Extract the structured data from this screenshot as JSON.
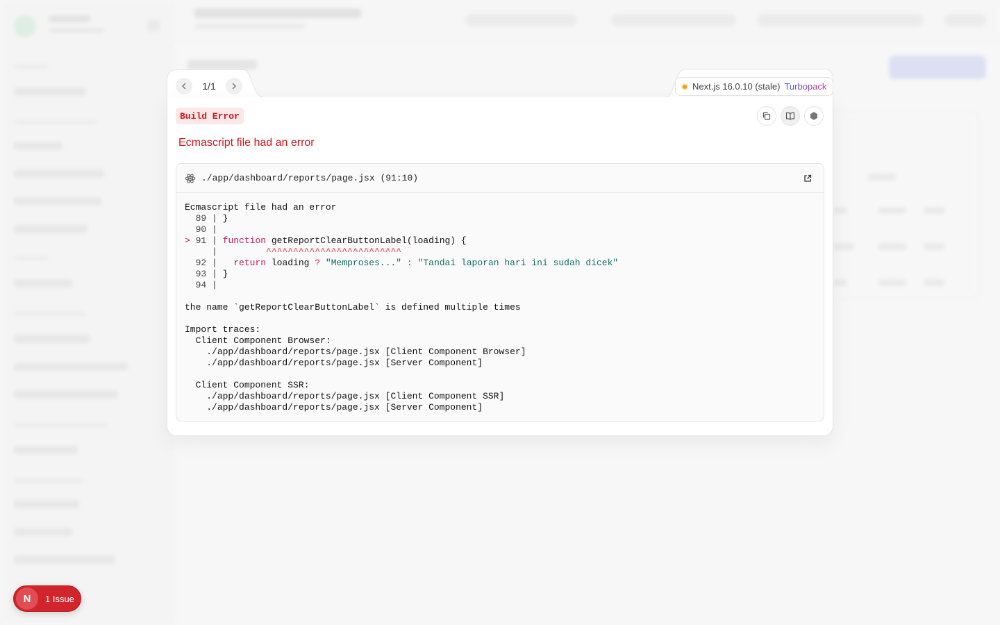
{
  "pager": {
    "label": "1/1"
  },
  "version": {
    "text": "Next.js 16.0.10 (stale)",
    "bundler": "Turbopack"
  },
  "badge": {
    "label": "Build Error"
  },
  "error": {
    "title": "Ecmascript file had an error"
  },
  "code": {
    "file": "./app/dashboard/reports/page.jsx (91:10)",
    "message_heading": "Ecmascript file had an error",
    "lines": [
      {
        "marker": " ",
        "num": "89",
        "text": "}"
      },
      {
        "marker": " ",
        "num": "90",
        "text": ""
      },
      {
        "marker": ">",
        "num": "91",
        "keyword": "function",
        "text": " getReportClearButtonLabel(loading) {"
      },
      {
        "marker": " ",
        "num": "",
        "carets": "^^^^^^^^^^^^^^^^^^^^^^^^^"
      },
      {
        "marker": " ",
        "num": "92",
        "keyword": "return",
        "text_before": " loading ",
        "op": "?",
        "string1": "\"Memproses...\"",
        "op2": ":",
        "string2": "\"Tandai laporan hari ini sudah dicek\""
      },
      {
        "marker": " ",
        "num": "93",
        "text": "}"
      },
      {
        "marker": " ",
        "num": "94",
        "text": ""
      }
    ],
    "detail": "the name `getReportClearButtonLabel` is defined multiple times",
    "import_traces_heading": "Import traces:",
    "traces": [
      {
        "name": "Client Component Browser:",
        "items": [
          "./app/dashboard/reports/page.jsx [Client Component Browser]",
          "./app/dashboard/reports/page.jsx [Server Component]"
        ]
      },
      {
        "name": "Client Component SSR:",
        "items": [
          "./app/dashboard/reports/page.jsx [Client Component SSR]",
          "./app/dashboard/reports/page.jsx [Server Component]"
        ]
      }
    ]
  },
  "issues": {
    "avatar": "N",
    "label": "1 Issue"
  },
  "colors": {
    "error_red": "#d0161b",
    "badge_bg": "#fde8e8",
    "status_dot": "#f5a000",
    "issue_pill": "#d1242b"
  },
  "icons": {
    "prev": "chevron-left-icon",
    "next": "chevron-right-icon",
    "copy": "copy-icon",
    "docs": "book-icon",
    "nodejs": "hexagon-icon",
    "file": "react-atom-icon",
    "open": "external-link-icon"
  }
}
